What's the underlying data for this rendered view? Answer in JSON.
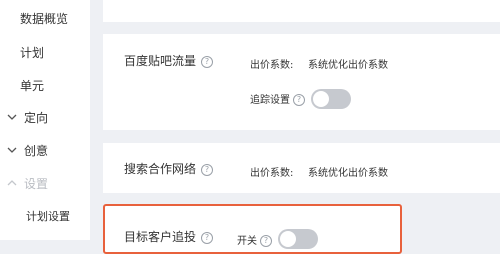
{
  "sidebar": {
    "items": [
      {
        "label": "数据概览"
      },
      {
        "label": "计划"
      },
      {
        "label": "单元"
      },
      {
        "label": "定向",
        "chevron": "down"
      },
      {
        "label": "创意",
        "chevron": "down"
      },
      {
        "label": "设置",
        "chevron": "up",
        "disabled": true
      },
      {
        "label": "计划设置"
      }
    ]
  },
  "main": {
    "tieba": {
      "title": "百度贴吧流量",
      "bid_label": "出价系数:",
      "bid_value": "系统优化出价系数",
      "tracking_label": "追踪设置",
      "tracking_on": false
    },
    "network": {
      "title": "搜索合作网络",
      "bid_label": "出价系数:",
      "bid_value": "系统优化出价系数"
    },
    "target": {
      "title": "目标客户追投",
      "switch_label": "开关",
      "switch_on": false
    }
  },
  "colors": {
    "highlight_border": "#e8613c",
    "toggle_off": "#c6c9cf",
    "background": "#eef0f4"
  }
}
